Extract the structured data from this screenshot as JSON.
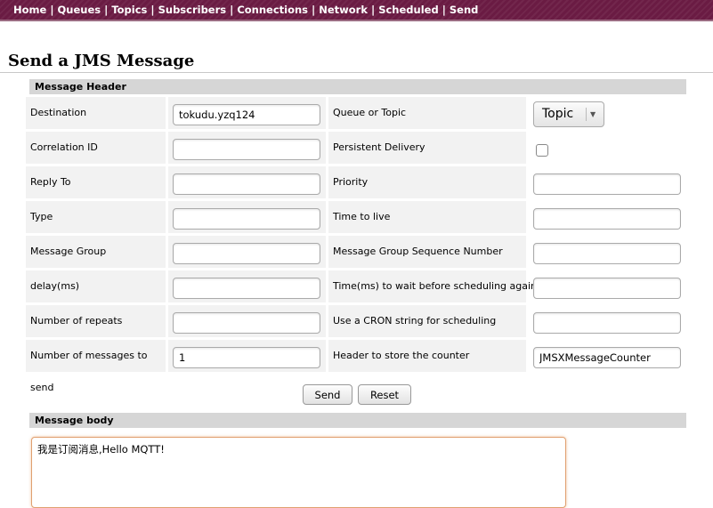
{
  "nav": {
    "items": [
      "Home",
      "Queues",
      "Topics",
      "Subscribers",
      "Connections",
      "Network",
      "Scheduled",
      "Send"
    ],
    "separator": "|"
  },
  "page_title": "Send a JMS Message",
  "message_header": {
    "title": "Message Header",
    "rows": [
      {
        "left_label": "Destination",
        "left_value": "tokudu.yzq124",
        "right_label": "Queue or Topic",
        "right_type": "select",
        "right_value": "Topic"
      },
      {
        "left_label": "Correlation ID",
        "left_value": "",
        "right_label": "Persistent Delivery",
        "right_type": "checkbox",
        "right_checked": false
      },
      {
        "left_label": "Reply To",
        "left_value": "",
        "right_label": "Priority",
        "right_type": "text",
        "right_value": ""
      },
      {
        "left_label": "Type",
        "left_value": "",
        "right_label": "Time to live",
        "right_type": "text",
        "right_value": ""
      },
      {
        "left_label": "Message Group",
        "left_value": "",
        "right_label": "Message Group Sequence Number",
        "right_type": "text",
        "right_value": ""
      },
      {
        "left_label": "delay(ms)",
        "left_value": "",
        "right_label": "Time(ms) to wait before scheduling again",
        "right_type": "text",
        "right_value": ""
      },
      {
        "left_label": "Number of repeats",
        "left_value": "",
        "right_label": "Use a CRON string for scheduling",
        "right_type": "text",
        "right_value": ""
      },
      {
        "left_label": "Number of messages to send",
        "left_value": "1",
        "right_label": "Header to store the counter",
        "right_type": "text",
        "right_value": "JMSXMessageCounter"
      }
    ]
  },
  "buttons": {
    "send": "Send",
    "reset": "Reset"
  },
  "message_body": {
    "title": "Message body",
    "value": "我是订阅消息,Hello MQTT!"
  },
  "colors": {
    "nav_bg": "#6a1b43",
    "section_bg": "#d6d6d6",
    "cell_bg": "#f2f2f2",
    "body_focus": "#e0a070"
  }
}
